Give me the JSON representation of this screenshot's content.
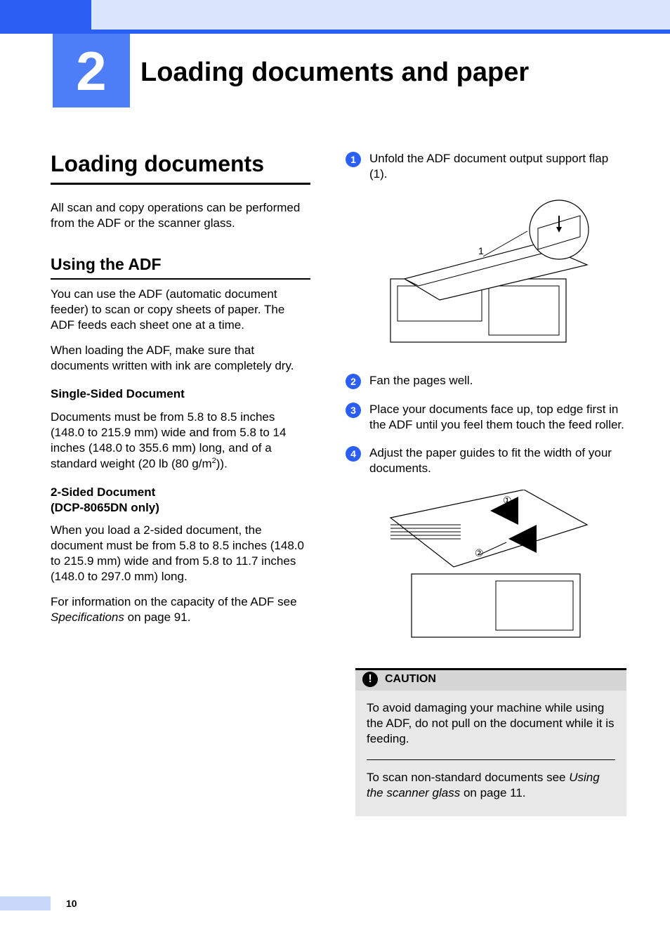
{
  "chapter": {
    "number": "2",
    "title": "Loading documents and paper"
  },
  "left": {
    "h1": "Loading documents",
    "intro": "All scan and copy operations can be performed from the ADF or the scanner glass.",
    "h2": "Using the ADF",
    "adf_p1": "You can use the ADF (automatic document feeder) to scan or copy sheets of paper. The ADF feeds each sheet one at a time.",
    "adf_p2": "When loading the ADF, make sure that documents written with ink are completely dry.",
    "single_hdr": "Single-Sided Document",
    "single_body_pre": "Documents must be from 5.8 to 8.5 inches (148.0 to 215.9 mm) wide and from 5.8 to 14 inches (148.0 to 355.6 mm) long, and of a standard weight (20 lb (80 g/m",
    "single_body_sup": "2",
    "single_body_post": ")).",
    "two_hdr_l1": "2-Sided Document",
    "two_hdr_l2": "(DCP-8065DN only)",
    "two_body": "When you load a 2-sided document, the document must be from 5.8 to 8.5 inches (148.0 to 215.9 mm) wide and from 5.8 to 11.7 inches (148.0 to 297.0 mm) long.",
    "specs_pre": "For information on the capacity of the ADF see ",
    "specs_em": "Specifications",
    "specs_post": " on page 91."
  },
  "right": {
    "steps": [
      {
        "num": "1",
        "text": "Unfold the ADF document output support flap (1)."
      },
      {
        "num": "2",
        "text": "Fan the pages well."
      },
      {
        "num": "3",
        "text": "Place your documents face up, top edge first in the ADF until you feel them touch the feed roller."
      },
      {
        "num": "4",
        "text": "Adjust the paper guides to fit the width of your documents."
      }
    ],
    "fig1_label": "1",
    "fig2_label1": "①",
    "fig2_label2": "②",
    "caution_label": "CAUTION",
    "caution_p1": "To avoid damaging your machine while using the ADF, do not pull on the document while it is feeding.",
    "caution_p2_pre": "To scan non-standard documents see ",
    "caution_p2_em": "Using the scanner glass",
    "caution_p2_post": " on page 11."
  },
  "page_number": "10"
}
